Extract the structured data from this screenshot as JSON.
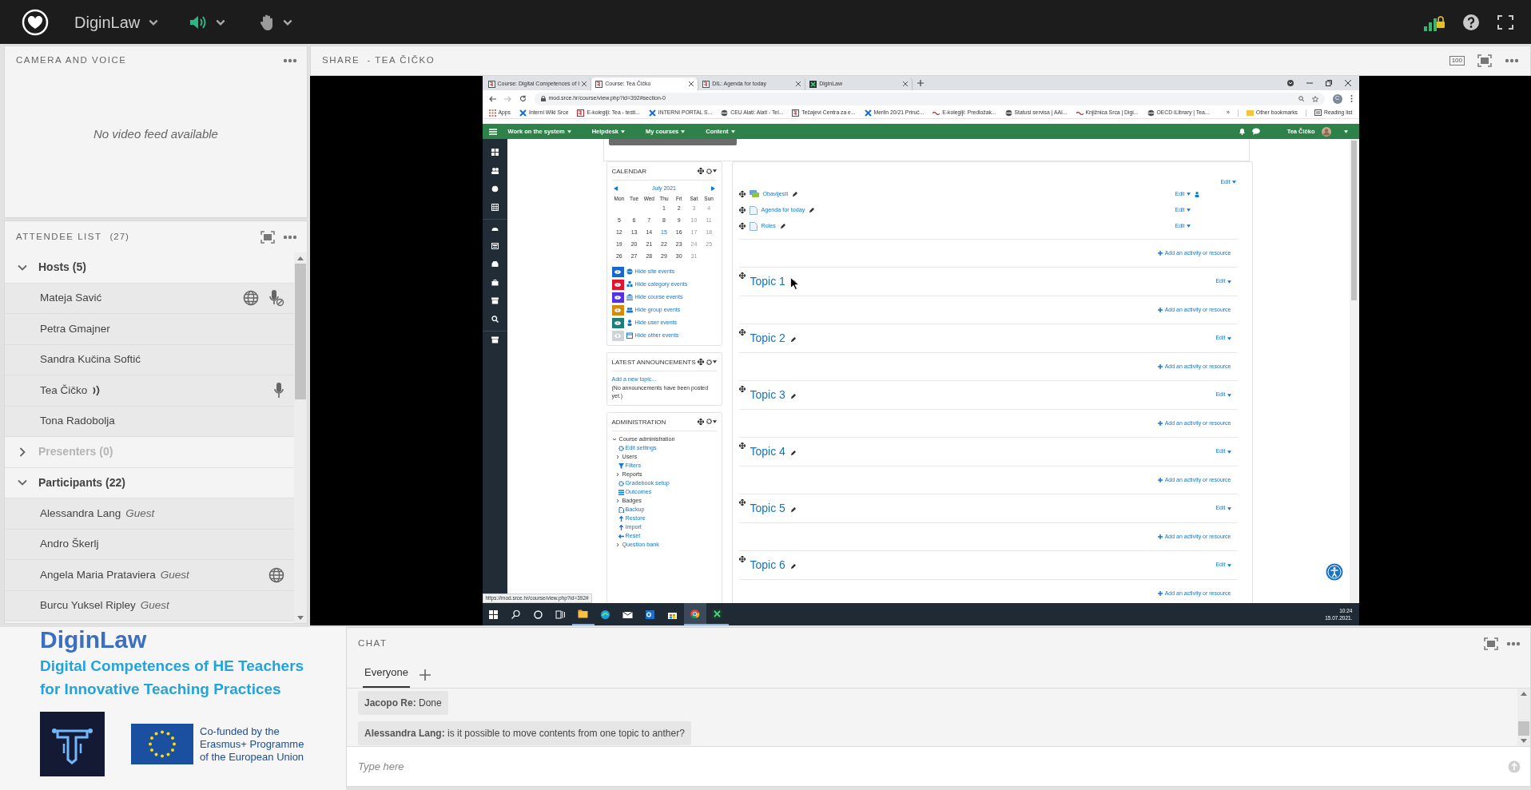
{
  "app": {
    "title": "DiginLaw"
  },
  "camera_pod": {
    "title": "CAMERA AND VOICE",
    "message": "No video feed available"
  },
  "attendee_pod": {
    "title": "ATTENDEE LIST",
    "count": "(27)",
    "groups": [
      {
        "label": "Hosts (5)",
        "expanded": true,
        "disabled": false,
        "people": [
          {
            "name": "Mateja Savić",
            "speaking": false,
            "globe": true,
            "mic_on": false,
            "mic_muted": true
          },
          {
            "name": "Petra Gmajner",
            "speaking": false,
            "globe": false,
            "mic_on": false,
            "mic_muted": false
          },
          {
            "name": "Sandra Kučina Softić",
            "speaking": false,
            "globe": false,
            "mic_on": false,
            "mic_muted": false
          },
          {
            "name": "Tea Čičko",
            "speaking": true,
            "globe": false,
            "mic_on": true,
            "mic_muted": false
          },
          {
            "name": "Tona Radobolja",
            "speaking": false,
            "globe": false,
            "mic_on": false,
            "mic_muted": false
          }
        ]
      },
      {
        "label": "Presenters (0)",
        "expanded": false,
        "disabled": true
      },
      {
        "label": "Participants (22)",
        "expanded": true,
        "disabled": false,
        "people": [
          {
            "name": "Alessandra Lang",
            "role": "Guest",
            "speaking": false,
            "globe": false,
            "mic_on": false,
            "mic_muted": false
          },
          {
            "name": "Andro Škerlj",
            "speaking": false,
            "globe": false,
            "mic_on": false,
            "mic_muted": false
          },
          {
            "name": "Angela Maria Prataviera",
            "role": "Guest",
            "speaking": false,
            "globe": true,
            "mic_on": false,
            "mic_muted": false
          },
          {
            "name": "Burcu Yuksel Ripley",
            "role": "Guest",
            "speaking": false,
            "globe": false,
            "mic_on": false,
            "mic_muted": false
          }
        ]
      }
    ]
  },
  "share_pod": {
    "title": "SHARE  - TEA ČIČKO",
    "zoom_label": "100"
  },
  "shared_screen": {
    "browser": {
      "tabs": [
        {
          "title": "Course: Digital Competences of I",
          "kind": "srce",
          "selected": false
        },
        {
          "title": "Course: Tea Čičko",
          "kind": "srce",
          "selected": true
        },
        {
          "title": "DIL: Agenda for today",
          "kind": "srce",
          "selected": false
        },
        {
          "title": "DiginLaw",
          "kind": "diginlaw",
          "selected": false
        }
      ],
      "address": "mod.srce.hr/course/view.php?id=392#section-0",
      "profile": "C",
      "bookmarks": [
        {
          "label": "Apps",
          "kind": "apps"
        },
        {
          "label": "Interni Wiki Srce",
          "kind": "cross"
        },
        {
          "label": "E-kolegiji: Tea - testi...",
          "kind": "srce"
        },
        {
          "label": "INTERNI PORTAL S...",
          "kind": "cross"
        },
        {
          "label": "CEU Alati: Alati - Tel...",
          "kind": "globe"
        },
        {
          "label": "Tečajevi Centra za e...",
          "kind": "srce"
        },
        {
          "label": "Merlin 20/21 Priruč...",
          "kind": "cross"
        },
        {
          "label": "E-kolegiji: Predložak...",
          "kind": "wave"
        },
        {
          "label": "Statusi servisa | AAI...",
          "kind": "globe"
        },
        {
          "label": "Knjižnica Srca | Digi...",
          "kind": "wave"
        },
        {
          "label": "OECD iLibrary | Tea...",
          "kind": "globe"
        }
      ],
      "overflow": "»",
      "other_bookmarks": "Other bookmarks",
      "reading_list": "Reading list"
    },
    "site": {
      "nav": [
        "Work on the system",
        "Helpdesk",
        "My courses",
        "Content"
      ],
      "user": "Tea Čičko",
      "calendar": {
        "title": "CALENDAR",
        "month": "July 2021",
        "weekdays": [
          "Mon",
          "Tue",
          "Wed",
          "Thu",
          "Fri",
          "Sat",
          "Sun"
        ],
        "weeks": [
          {
            "starts_mid_week": true,
            "days": [
              "1",
              "2",
              "3",
              "4"
            ]
          },
          {
            "days": [
              "5",
              "6",
              "7",
              "8",
              "9",
              "10",
              "11"
            ]
          },
          {
            "days": [
              "12",
              "13",
              "14",
              {
                "text": "15",
                "today": true
              },
              "16",
              "17",
              "18"
            ]
          },
          {
            "days": [
              "19",
              "20",
              "21",
              "22",
              "23",
              "24",
              "25"
            ]
          },
          {
            "starts_mid_week": false,
            "days": [
              "26",
              "27",
              "28",
              "29",
              "30",
              "31"
            ]
          }
        ],
        "filters": [
          {
            "kind": "site",
            "label": "Hide site events",
            "color": "#1a66d0"
          },
          {
            "kind": "category",
            "label": "Hide category events",
            "color": "#e0142f"
          },
          {
            "kind": "course",
            "label": "Hide course events",
            "color": "#5232e8"
          },
          {
            "kind": "group",
            "label": "Hide group events",
            "color": "#d68a0c"
          },
          {
            "kind": "user",
            "label": "Hide user events",
            "color": "#1e7c7c"
          },
          {
            "kind": "other",
            "label": "Hide other events",
            "color": "#ced4da"
          }
        ]
      },
      "announcements": {
        "title": "LATEST ANNOUNCEMENTS",
        "link": "Add a new topic...",
        "note": "(No announcements have been posted yet.)"
      },
      "administration": {
        "title": "ADMINISTRATION",
        "tree": [
          {
            "label": "Course administration",
            "kind": "branch",
            "expanded": true,
            "children": [
              {
                "label": "Edit settings",
                "kind": "settings"
              },
              {
                "label": "Users",
                "kind": "branch",
                "expanded": false
              },
              {
                "label": "Filters",
                "kind": "filter"
              },
              {
                "label": "Reports",
                "kind": "branch",
                "expanded": false
              },
              {
                "label": "Gradebook setup",
                "kind": "settings"
              },
              {
                "label": "Outcomes",
                "kind": "outcomes"
              },
              {
                "label": "Badges",
                "kind": "branch",
                "expanded": false
              },
              {
                "label": "Backup",
                "kind": "backup"
              },
              {
                "label": "Restore",
                "kind": "restore"
              },
              {
                "label": "Import",
                "kind": "restore"
              },
              {
                "label": "Reset",
                "kind": "reset"
              },
              {
                "label": "Question bank",
                "kind": "branch",
                "expanded": false
              }
            ]
          }
        ]
      },
      "course": {
        "edit": "Edit",
        "activities": [
          {
            "kind": "forum",
            "name": "Obavijesti",
            "edit": "Edit",
            "restricted": true
          },
          {
            "kind": "page",
            "name": "Agenda for today",
            "edit": "Edit",
            "restricted": false
          },
          {
            "kind": "page",
            "name": "Roles",
            "edit": "Edit",
            "restricted": false
          }
        ],
        "add": "Add an activity or resource",
        "topics": [
          {
            "title": "Topic 1",
            "edit": "Edit",
            "add": "Add an activity or resource"
          },
          {
            "title": "Topic 2",
            "edit": "Edit",
            "add": "Add an activity or resource"
          },
          {
            "title": "Topic 3",
            "edit": "Edit",
            "add": "Add an activity or resource"
          },
          {
            "title": "Topic 4",
            "edit": "Edit",
            "add": "Add an activity or resource"
          },
          {
            "title": "Topic 5",
            "edit": "Edit",
            "add": "Add an activity or resource"
          },
          {
            "title": "Topic 6",
            "edit": "Edit",
            "add": "Add an activity or resource"
          }
        ]
      }
    },
    "status_url": "https://mod.srce.hr/course/view.php?id=392#",
    "taskbar": {
      "time": "10:24",
      "date": "15.07.2021."
    }
  },
  "branding": {
    "title": "DiginLaw",
    "subtitle": [
      "Digital Competences of HE Teachers",
      "for Innovative Teaching Practices"
    ],
    "eu_text": [
      "Co-funded by the",
      "Erasmus+ Programme",
      "of the European Union"
    ]
  },
  "chat": {
    "title": "CHAT",
    "tabs": [
      {
        "label": "Everyone",
        "selected": true
      }
    ],
    "messages": [
      {
        "sender": "Jacopo Re:",
        "text": "Done"
      },
      {
        "sender": "Alessandra Lang:",
        "text": "is it possible to move contents from one topic to anther?"
      }
    ],
    "placeholder": "Type here"
  }
}
